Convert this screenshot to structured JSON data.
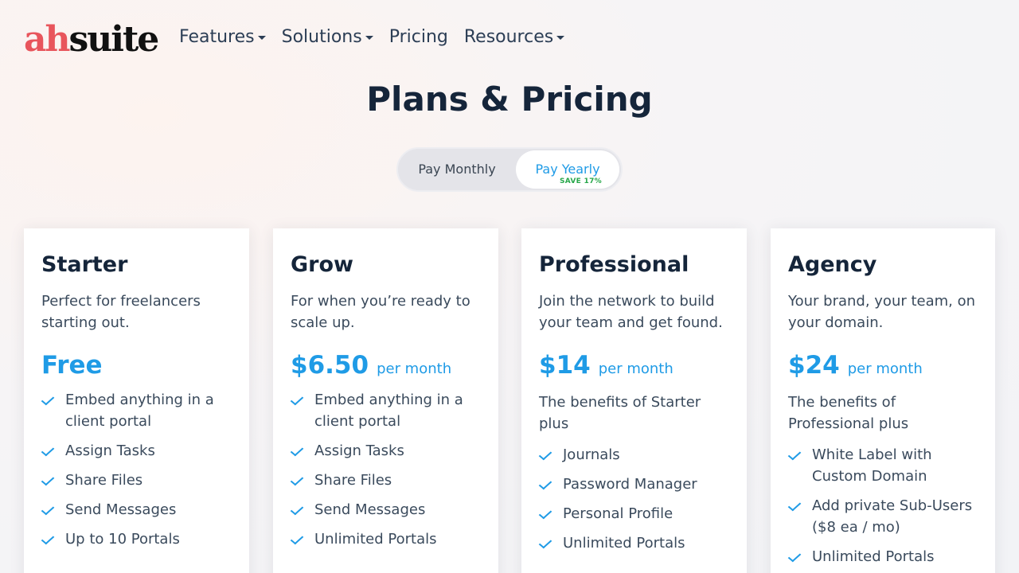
{
  "logo": {
    "part1": "ah",
    "part2": "suite"
  },
  "nav": [
    {
      "label": "Features",
      "dropdown": true
    },
    {
      "label": "Solutions",
      "dropdown": true
    },
    {
      "label": "Pricing",
      "dropdown": false
    },
    {
      "label": "Resources",
      "dropdown": true
    }
  ],
  "page_title": "Plans & Pricing",
  "billing_toggle": {
    "monthly": "Pay Monthly",
    "yearly": "Pay Yearly",
    "save_badge": "SAVE 17%",
    "selected": "yearly"
  },
  "accent_color": "#1f9be6",
  "plans": [
    {
      "name": "Starter",
      "description": "Perfect for freelancers starting out.",
      "price": "Free",
      "per": "",
      "intro": "",
      "features": [
        "Embed anything in a client portal",
        "Assign Tasks",
        "Share Files",
        "Send Messages",
        "Up to 10 Portals"
      ]
    },
    {
      "name": "Grow",
      "description": "For when you’re ready to scale up.",
      "price": "$6.50",
      "per": "per month",
      "intro": "",
      "features": [
        "Embed anything in a client portal",
        "Assign Tasks",
        "Share Files",
        "Send Messages",
        "Unlimited Portals"
      ]
    },
    {
      "name": "Professional",
      "description": "Join the network to build your team and get found.",
      "price": "$14",
      "per": "per month",
      "intro": "The benefits of Starter plus",
      "features": [
        "Journals",
        "Password Manager",
        "Personal Profile",
        "Unlimited Portals"
      ]
    },
    {
      "name": "Agency",
      "description": "Your brand, your team, on your domain.",
      "price": "$24",
      "per": "per month",
      "intro": "The benefits of Professional plus",
      "features": [
        "White Label with Custom Domain",
        "Add private Sub-Users ($8 ea / mo)",
        "Unlimited Portals"
      ]
    }
  ]
}
